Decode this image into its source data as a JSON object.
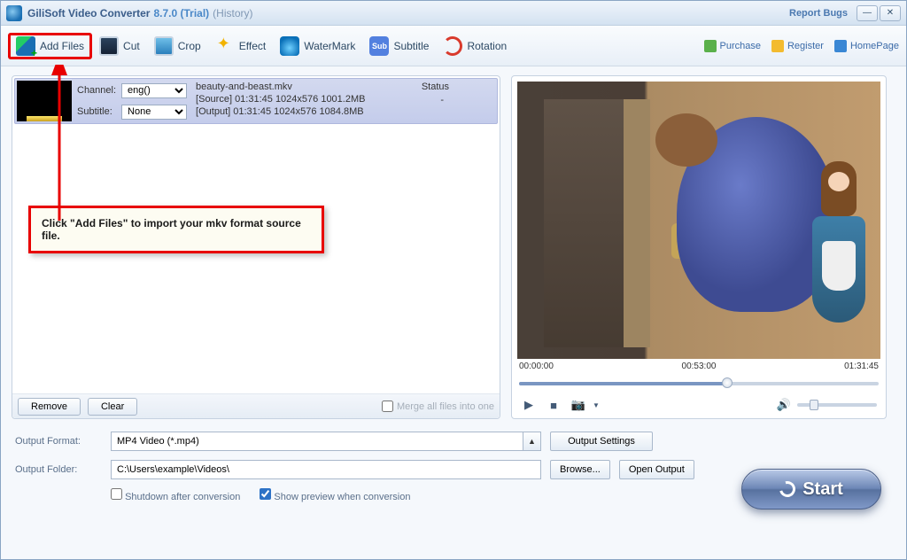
{
  "title": {
    "app": "GiliSoft Video Converter",
    "version": "8.7.0 (Trial)",
    "history": "(History)",
    "report": "Report Bugs"
  },
  "toolbar": {
    "addfiles": "Add Files",
    "cut": "Cut",
    "crop": "Crop",
    "effect": "Effect",
    "watermark": "WaterMark",
    "subtitle": "Subtitle",
    "rotation": "Rotation",
    "purchase": "Purchase",
    "register": "Register",
    "homepage": "HomePage"
  },
  "file": {
    "channel_label": "Channel:",
    "channel_value": "eng()",
    "subtitle_label": "Subtitle:",
    "subtitle_value": "None",
    "name": "beauty-and-beast.mkv",
    "source": "[Source]  01:31:45  1024x576  1001.2MB",
    "output": "[Output]  01:31:45  1024x576  1084.8MB",
    "status_label": "Status",
    "status_value": "-"
  },
  "listfooter": {
    "remove": "Remove",
    "clear": "Clear",
    "merge": "Merge all files into one"
  },
  "preview": {
    "t0": "00:00:00",
    "t1": "00:53:00",
    "t2": "01:31:45"
  },
  "callout": "Click \"Add Files\" to import your mkv format source file.",
  "bottom": {
    "format_label": "Output Format:",
    "format_value": "MP4 Video (*.mp4)",
    "output_settings": "Output Settings",
    "folder_label": "Output Folder:",
    "folder_value": "C:\\Users\\example\\Videos\\",
    "browse": "Browse...",
    "open_output": "Open Output",
    "shutdown": "Shutdown after conversion",
    "preview": "Show preview when conversion",
    "start": "Start"
  }
}
